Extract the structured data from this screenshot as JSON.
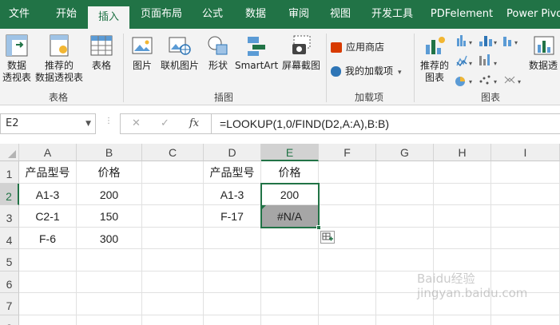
{
  "tabs": [
    "文件",
    "开始",
    "插入",
    "页面布局",
    "公式",
    "数据",
    "审阅",
    "视图",
    "开发工具",
    "PDFelement",
    "Power Pivo"
  ],
  "active_tab": "插入",
  "ribbon": {
    "pivot_table": "数据\n透视表",
    "recommended_pivot": "推荐的\n数据透视表",
    "table": "表格",
    "group_tables": "表格",
    "pictures": "图片",
    "online_pictures": "联机图片",
    "shapes": "形状",
    "smartart": "SmartArt",
    "screenshot": "屏幕截图",
    "group_illustrations": "插图",
    "store": "应用商店",
    "my_addins": "我的加载项",
    "group_addins": "加载项",
    "recommended_charts": "推荐的\n图表",
    "pivot_chart": "数据透",
    "group_charts": "图表"
  },
  "formula_bar": {
    "name_box": "E2",
    "cancel": "✕",
    "enter": "✓",
    "fx": "fx",
    "formula": "=LOOKUP(1,0/FIND(D2,A:A),B:B)"
  },
  "columns": [
    "A",
    "B",
    "C",
    "D",
    "E",
    "F",
    "G",
    "H",
    "I"
  ],
  "rows": [
    "1",
    "2",
    "3",
    "4",
    "5",
    "6",
    "7",
    "8"
  ],
  "cells": {
    "A1": "产品型号",
    "B1": "价格",
    "A2": "A1-3",
    "B2": "200",
    "A3": "C2-1",
    "B3": "150",
    "A4": "F-6",
    "B4": "300",
    "D1": "产品型号",
    "E1": "价格",
    "D2": "A1-3",
    "E2": "200",
    "D3": "F-17",
    "E3": "#N/A"
  },
  "selected_cell": "E2",
  "watermark": "Baidu经验 jingyan.baidu.com",
  "colors": {
    "brand": "#217346",
    "ribbon_bg": "#f3f3f3",
    "error_fill": "#a6a6a6"
  }
}
